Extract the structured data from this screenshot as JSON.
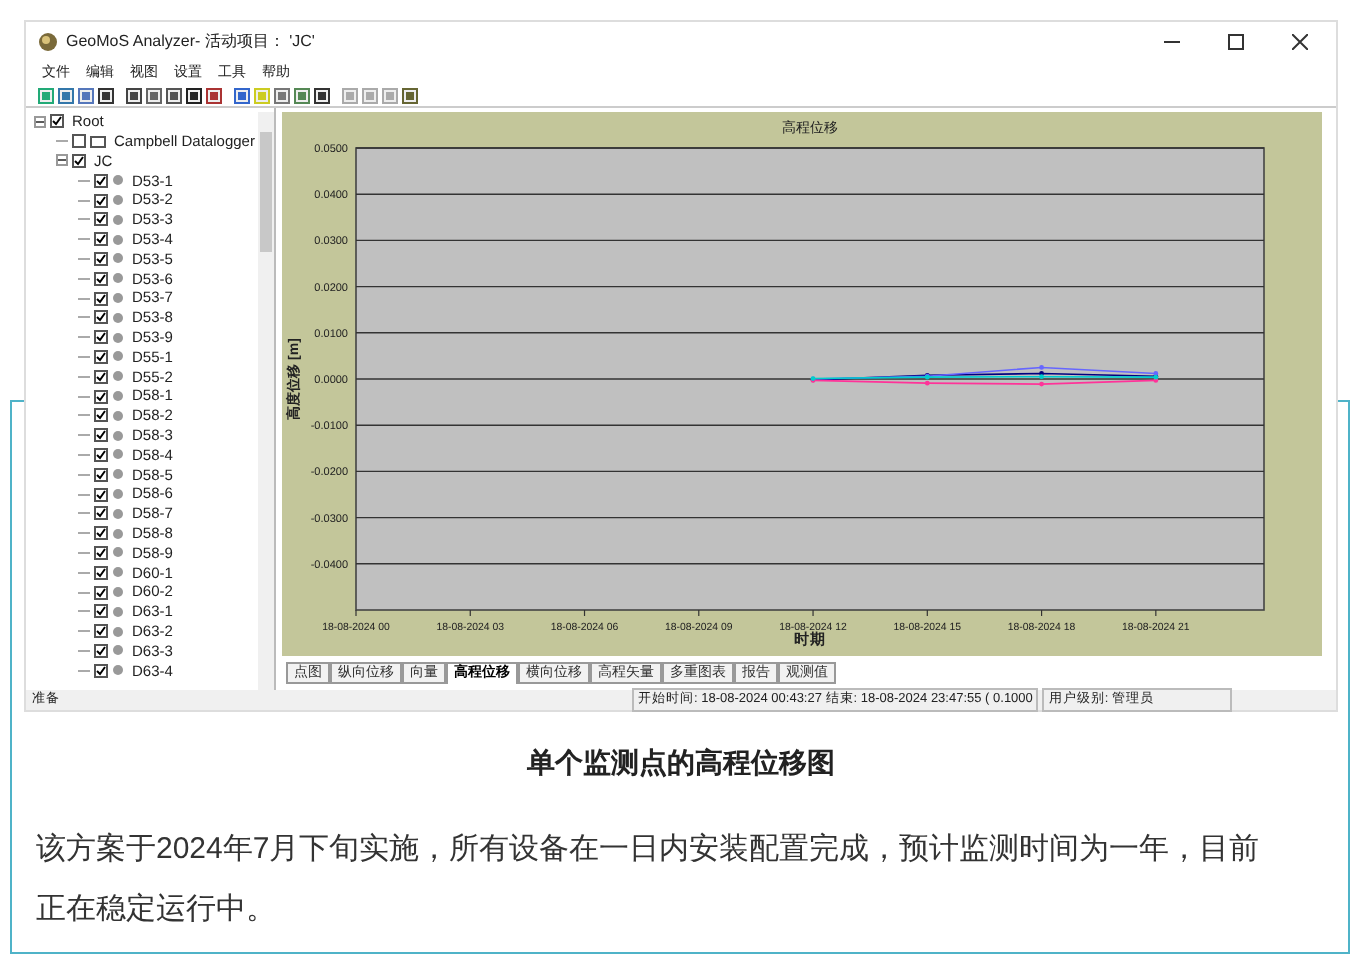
{
  "window": {
    "title": "GeoMoS Analyzer- 活动项目： 'JC'"
  },
  "menu": [
    "文件",
    "编辑",
    "视图",
    "设置",
    "工具",
    "帮助"
  ],
  "tree": [
    {
      "label": "Root",
      "checked": true,
      "expanded": true,
      "children": [
        {
          "label": "Campbell Datalogger",
          "checked": false
        },
        {
          "label": "JC",
          "checked": true,
          "expanded": true,
          "children": [
            {
              "label": "D53-1",
              "checked": true
            },
            {
              "label": "D53-2",
              "checked": true
            },
            {
              "label": "D53-3",
              "checked": true
            },
            {
              "label": "D53-4",
              "checked": true
            },
            {
              "label": "D53-5",
              "checked": true
            },
            {
              "label": "D53-6",
              "checked": true
            },
            {
              "label": "D53-7",
              "checked": true
            },
            {
              "label": "D53-8",
              "checked": true
            },
            {
              "label": "D53-9",
              "checked": true
            },
            {
              "label": "D55-1",
              "checked": true
            },
            {
              "label": "D55-2",
              "checked": true
            },
            {
              "label": "D58-1",
              "checked": true
            },
            {
              "label": "D58-2",
              "checked": true
            },
            {
              "label": "D58-3",
              "checked": true
            },
            {
              "label": "D58-4",
              "checked": true
            },
            {
              "label": "D58-5",
              "checked": true
            },
            {
              "label": "D58-6",
              "checked": true
            },
            {
              "label": "D58-7",
              "checked": true
            },
            {
              "label": "D58-8",
              "checked": true
            },
            {
              "label": "D58-9",
              "checked": true
            },
            {
              "label": "D60-1",
              "checked": true
            },
            {
              "label": "D60-2",
              "checked": true
            },
            {
              "label": "D63-1",
              "checked": true
            },
            {
              "label": "D63-2",
              "checked": true
            },
            {
              "label": "D63-3",
              "checked": true
            },
            {
              "label": "D63-4",
              "checked": true
            }
          ]
        }
      ]
    }
  ],
  "chart": {
    "chart_data": {
      "type": "line",
      "title": "高程位移",
      "xlabel": "时期",
      "ylabel": "高度位移 [m]",
      "grid": true,
      "ylim": [
        -0.05,
        0.05
      ],
      "categories": [
        "18-08-2024 00",
        "18-08-2024 03",
        "18-08-2024 06",
        "18-08-2024 09",
        "18-08-2024 12",
        "18-08-2024 15",
        "18-08-2024 18",
        "18-08-2024 21"
      ],
      "yticks": [
        {
          "value": 0.05,
          "label": "0.0500"
        },
        {
          "value": 0.04,
          "label": "0.0400"
        },
        {
          "value": 0.03,
          "label": "0.0300"
        },
        {
          "value": 0.02,
          "label": "0.0200"
        },
        {
          "value": 0.01,
          "label": "0.0100"
        },
        {
          "value": 0,
          "label": "0.0000"
        },
        {
          "value": -0.01,
          "label": "-0.0100"
        },
        {
          "value": -0.02,
          "label": "-0.0200"
        },
        {
          "value": -0.03,
          "label": "-0.0300"
        },
        {
          "value": -0.04,
          "label": "-0.0400"
        }
      ],
      "series": [
        {
          "color": "#000080",
          "values": [
            null,
            null,
            null,
            null,
            -0.0002,
            0.0008,
            0.0012,
            0.0006
          ]
        },
        {
          "color": "#6666ff",
          "values": [
            null,
            null,
            null,
            null,
            0.0,
            0.0006,
            0.0025,
            0.0012
          ]
        },
        {
          "color": "#ff3399",
          "values": [
            null,
            null,
            null,
            null,
            -0.0003,
            -0.0009,
            -0.0011,
            -0.0003
          ]
        },
        {
          "color": "#00cccc",
          "values": [
            null,
            null,
            null,
            null,
            0.0001,
            0.0004,
            0.0005,
            0.0004
          ]
        }
      ]
    }
  },
  "tabs": [
    {
      "label": "点图",
      "selected": false
    },
    {
      "label": "纵向位移",
      "selected": false
    },
    {
      "label": "向量",
      "selected": false
    },
    {
      "label": "高程位移",
      "selected": true
    },
    {
      "label": "横向位移",
      "selected": false
    },
    {
      "label": "高程矢量",
      "selected": false
    },
    {
      "label": "多重图表",
      "selected": false
    },
    {
      "label": "报告",
      "selected": false
    },
    {
      "label": "观测值",
      "selected": false
    }
  ],
  "status_bar": {
    "state": "准备",
    "time_range": "开始时间:  18-08-2024 00:43:27  结束:  18-08-2024 23:47:55 ( 0.1000",
    "user": "用户级别: 管理员"
  },
  "caption": "单个监测点的高程位移图",
  "paragraph": "该方案于2024年7月下旬实施，所有设备在一日内安装配置完成，预计监测时间为一年，目前正在稳定运行中。"
}
